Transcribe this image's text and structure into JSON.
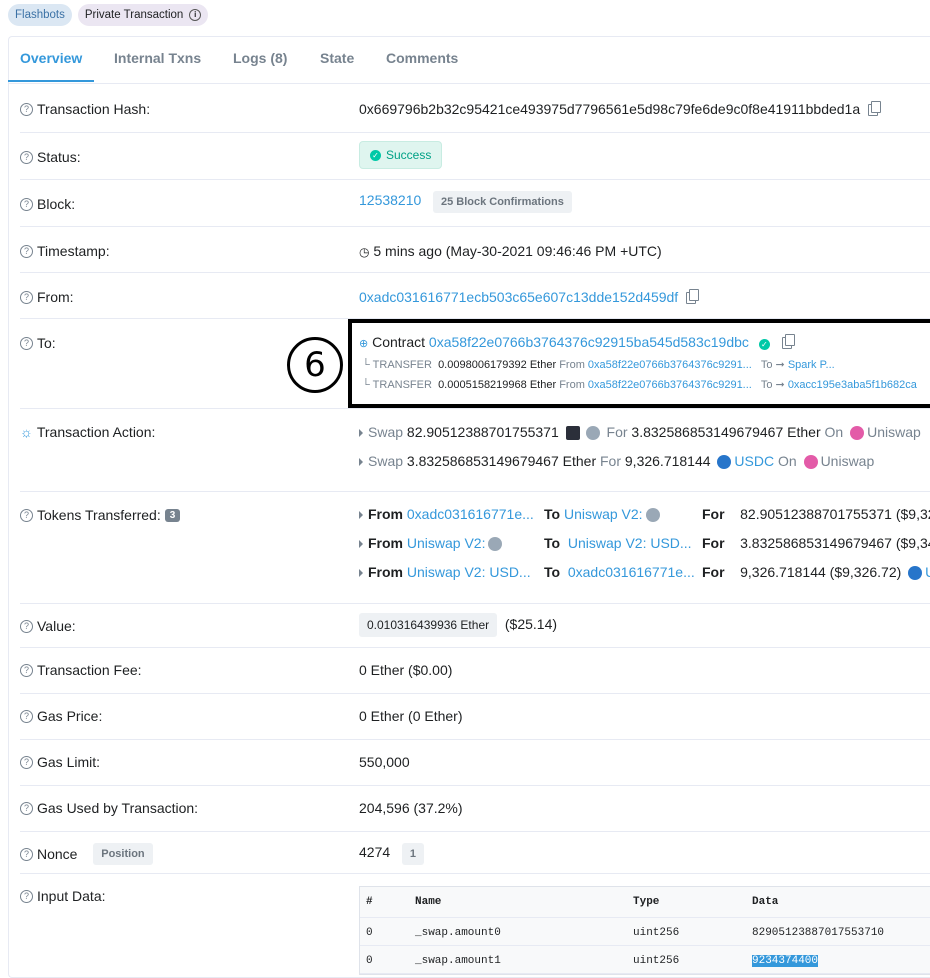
{
  "badges": {
    "flashbots": "Flashbots",
    "private": "Private Transaction",
    "info_icon": "info-circle-icon"
  },
  "tabs": [
    {
      "label": "Overview",
      "active": true
    },
    {
      "label": "Internal Txns"
    },
    {
      "label": "Logs (8)"
    },
    {
      "label": "State"
    },
    {
      "label": "Comments"
    }
  ],
  "rows": {
    "hash": {
      "label": "Transaction Hash:",
      "value": "0x669796b2b32c95421ce493975d7796561e5d98c79fe6de9c0f8e41911bbded1a"
    },
    "status": {
      "label": "Status:",
      "value": "Success"
    },
    "block": {
      "label": "Block:",
      "value": "12538210",
      "confirmations": "25 Block Confirmations"
    },
    "timestamp": {
      "label": "Timestamp:",
      "value": "5 mins ago (May-30-2021 09:46:46 PM +UTC)"
    },
    "from": {
      "label": "From:",
      "value": "0xadc031616771ecb503c65e607c13dde152d459df"
    },
    "to": {
      "label": "To:",
      "contract_prefix": "Contract",
      "contract": "0xa58f22e0766b3764376c92915ba545d583c19dbc",
      "transfers": [
        {
          "kind": "TRANSFER",
          "amount": "0.0098006179392 Ether",
          "from_label": "From",
          "from": "0xa58f22e0766b3764376c9291...",
          "to_label": "To",
          "to": "Spark P..."
        },
        {
          "kind": "TRANSFER",
          "amount": "0.0005158219968 Ether",
          "from_label": "From",
          "from": "0xa58f22e0766b3764376c9291...",
          "to_label": "To",
          "to": "0xacc195e3aba5f1b682ca"
        }
      ]
    },
    "action": {
      "label": "Transaction Action:",
      "lines": [
        {
          "swap": "Swap",
          "amount": "82.90512388701755371",
          "for": "For",
          "amount2": "3.832586853149679467 Ether",
          "on": "On",
          "venue": "Uniswap"
        },
        {
          "swap": "Swap",
          "amount": "3.832586853149679467 Ether",
          "for": "For",
          "amount2": "9,326.718144",
          "token2": "USDC",
          "on": "On",
          "venue": "Uniswap"
        }
      ]
    },
    "tokens": {
      "label": "Tokens Transferred:",
      "count": "3",
      "lines": [
        {
          "from": "0xadc031616771e...",
          "to": "Uniswap V2:",
          "for": "82.90512388701755371",
          "usd": "($9,32"
        },
        {
          "from": "Uniswap V2:",
          "to": "Uniswap V2: USD...",
          "for": "3.832586853149679467",
          "usd": "($9,34"
        },
        {
          "from": "Uniswap V2: USD...",
          "to": "0xadc031616771e...",
          "for": "9,326.718144",
          "usd": "($9,326.72)",
          "tail": "U"
        }
      ],
      "from_label": "From",
      "to_label": "To",
      "for_label": "For"
    },
    "value": {
      "label": "Value:",
      "eth": "0.010316439936 Ether",
      "usd": "($25.14)"
    },
    "fee": {
      "label": "Transaction Fee:",
      "value": "0 Ether ($0.00)"
    },
    "gas_price": {
      "label": "Gas Price:",
      "value": "0 Ether (0 Ether)"
    },
    "gas_limit": {
      "label": "Gas Limit:",
      "value": "550,000"
    },
    "gas_used": {
      "label": "Gas Used by Transaction:",
      "value": "204,596 (37.2%)"
    },
    "nonce": {
      "label": "Nonce",
      "position_label": "Position",
      "value": "4274",
      "position": "1"
    },
    "input": {
      "label": "Input Data:",
      "headers": [
        "#",
        "Name",
        "Type",
        "Data"
      ],
      "rows": [
        [
          "0",
          "_swap.amount0",
          "uint256",
          "82905123887017553710"
        ],
        [
          "0",
          "_swap.amount1",
          "uint256",
          "9234374400"
        ]
      ]
    }
  },
  "annotation": {
    "number": "6"
  }
}
